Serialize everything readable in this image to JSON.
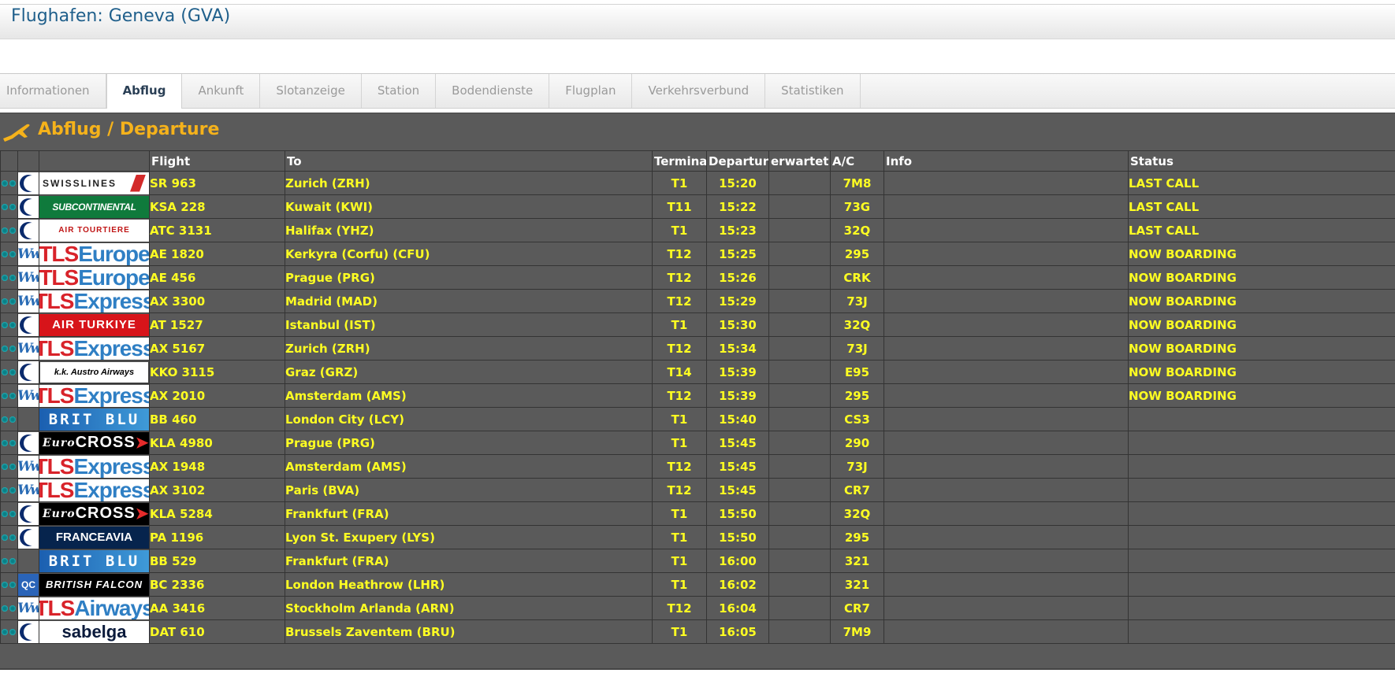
{
  "header": {
    "title": "Flughafen: Geneva (GVA)"
  },
  "tabs": [
    {
      "label": "Informationen",
      "active": false
    },
    {
      "label": "Abflug",
      "active": true
    },
    {
      "label": "Ankunft",
      "active": false
    },
    {
      "label": "Slotanzeige",
      "active": false
    },
    {
      "label": "Station",
      "active": false
    },
    {
      "label": "Bodendienste",
      "active": false
    },
    {
      "label": "Flugplan",
      "active": false
    },
    {
      "label": "Verkehrsverbund",
      "active": false
    },
    {
      "label": "Statistiken",
      "active": false
    }
  ],
  "board": {
    "title": "Abflug / Departure",
    "title_icon": "plane-departure-icon",
    "accent_color": "#f5b21b",
    "text_color": "#ffff22",
    "columns": {
      "flight": "Flight",
      "to": "To",
      "terminal": "Terminal",
      "departure": "Departure",
      "expected": "erwartet",
      "ac": "A/C",
      "info": "Info",
      "status": "Status"
    },
    "rows": [
      {
        "mini": "crescent",
        "logo": {
          "style": "swiss",
          "text": "SWISSLINES"
        },
        "flight": "SR 963",
        "to": "Zurich (ZRH)",
        "terminal": "T1",
        "departure": "15:20",
        "expected": "",
        "ac": "7M8",
        "info": "",
        "status": "LAST CALL"
      },
      {
        "mini": "crescent",
        "logo": {
          "style": "subcont",
          "text": "SUBCONTINENTAL"
        },
        "flight": "KSA 228",
        "to": "Kuwait (KWI)",
        "terminal": "T11",
        "departure": "15:22",
        "expected": "",
        "ac": "73G",
        "info": "",
        "status": "LAST CALL"
      },
      {
        "mini": "crescent",
        "logo": {
          "style": "tourair",
          "text": "AIR TOURTIERE"
        },
        "flight": "ATC 3131",
        "to": "Halifax (YHZ)",
        "terminal": "T1",
        "departure": "15:23",
        "expected": "",
        "ac": "32Q",
        "info": "",
        "status": "LAST CALL"
      },
      {
        "mini": "ww",
        "logo": {
          "style": "tls",
          "a": "TLS",
          "b": "Europe"
        },
        "flight": "AE 1820",
        "to": "Kerkyra (Corfu) (CFU)",
        "terminal": "T12",
        "departure": "15:25",
        "expected": "",
        "ac": "295",
        "info": "",
        "status": "NOW BOARDING"
      },
      {
        "mini": "ww",
        "logo": {
          "style": "tls",
          "a": "TLS",
          "b": "Europe"
        },
        "flight": "AE 456",
        "to": "Prague (PRG)",
        "terminal": "T12",
        "departure": "15:26",
        "expected": "",
        "ac": "CRK",
        "info": "",
        "status": "NOW BOARDING"
      },
      {
        "mini": "ww",
        "logo": {
          "style": "tls",
          "a": "TLS",
          "b": "Express"
        },
        "flight": "AX 3300",
        "to": "Madrid (MAD)",
        "terminal": "T12",
        "departure": "15:29",
        "expected": "",
        "ac": "73J",
        "info": "",
        "status": "NOW BOARDING"
      },
      {
        "mini": "crescent",
        "logo": {
          "style": "turk",
          "text": "AIR TURKIYE"
        },
        "flight": "AT 1527",
        "to": "Istanbul (IST)",
        "terminal": "T1",
        "departure": "15:30",
        "expected": "",
        "ac": "32Q",
        "info": "",
        "status": "NOW BOARDING"
      },
      {
        "mini": "ww",
        "logo": {
          "style": "tls",
          "a": "TLS",
          "b": "Express"
        },
        "flight": "AX 5167",
        "to": "Zurich (ZRH)",
        "terminal": "T12",
        "departure": "15:34",
        "expected": "",
        "ac": "73J",
        "info": "",
        "status": "NOW BOARDING"
      },
      {
        "mini": "crescent",
        "logo": {
          "style": "austro",
          "text": "k.k. Austro Airways"
        },
        "flight": "KKO 3115",
        "to": "Graz (GRZ)",
        "terminal": "T14",
        "departure": "15:39",
        "expected": "",
        "ac": "E95",
        "info": "",
        "status": "NOW BOARDING"
      },
      {
        "mini": "ww",
        "logo": {
          "style": "tls",
          "a": "TLS",
          "b": "Express"
        },
        "flight": "AX 2010",
        "to": "Amsterdam (AMS)",
        "terminal": "T12",
        "departure": "15:39",
        "expected": "",
        "ac": "295",
        "info": "",
        "status": "NOW BOARDING"
      },
      {
        "mini": "empty",
        "logo": {
          "style": "brit",
          "text": "BRIT BLU"
        },
        "flight": "BB 460",
        "to": "London City (LCY)",
        "terminal": "T1",
        "departure": "15:40",
        "expected": "",
        "ac": "CS3",
        "info": "",
        "status": ""
      },
      {
        "mini": "crescent",
        "logo": {
          "style": "euro",
          "a": "Euro",
          "b": "CROSS"
        },
        "flight": "KLA 4980",
        "to": "Prague (PRG)",
        "terminal": "T1",
        "departure": "15:45",
        "expected": "",
        "ac": "290",
        "info": "",
        "status": ""
      },
      {
        "mini": "ww",
        "logo": {
          "style": "tls",
          "a": "TLS",
          "b": "Express"
        },
        "flight": "AX 1948",
        "to": "Amsterdam (AMS)",
        "terminal": "T12",
        "departure": "15:45",
        "expected": "",
        "ac": "73J",
        "info": "",
        "status": ""
      },
      {
        "mini": "ww",
        "logo": {
          "style": "tls",
          "a": "TLS",
          "b": "Express"
        },
        "flight": "AX 3102",
        "to": "Paris (BVA)",
        "terminal": "T12",
        "departure": "15:45",
        "expected": "",
        "ac": "CR7",
        "info": "",
        "status": ""
      },
      {
        "mini": "crescent",
        "logo": {
          "style": "euro",
          "a": "Euro",
          "b": "CROSS"
        },
        "flight": "KLA 5284",
        "to": "Frankfurt (FRA)",
        "terminal": "T1",
        "departure": "15:50",
        "expected": "",
        "ac": "32Q",
        "info": "",
        "status": ""
      },
      {
        "mini": "crescent",
        "logo": {
          "style": "france",
          "text": "FRANCEAVIA"
        },
        "flight": "PA 1196",
        "to": "Lyon St. Exupery (LYS)",
        "terminal": "T1",
        "departure": "15:50",
        "expected": "",
        "ac": "295",
        "info": "",
        "status": ""
      },
      {
        "mini": "empty",
        "logo": {
          "style": "brit",
          "text": "BRIT BLU"
        },
        "flight": "BB 529",
        "to": "Frankfurt (FRA)",
        "terminal": "T1",
        "departure": "16:00",
        "expected": "",
        "ac": "321",
        "info": "",
        "status": ""
      },
      {
        "mini": "qc",
        "logo": {
          "style": "falcon",
          "text": "BRITISH FALCON"
        },
        "flight": "BC 2336",
        "to": "London Heathrow (LHR)",
        "terminal": "T1",
        "departure": "16:02",
        "expected": "",
        "ac": "321",
        "info": "",
        "status": ""
      },
      {
        "mini": "ww",
        "logo": {
          "style": "tls",
          "a": "TLS",
          "b": "Airways"
        },
        "flight": "AA 3416",
        "to": "Stockholm Arlanda (ARN)",
        "terminal": "T12",
        "departure": "16:04",
        "expected": "",
        "ac": "CR7",
        "info": "",
        "status": ""
      },
      {
        "mini": "crescent",
        "logo": {
          "style": "sabelga",
          "text": "sabelga"
        },
        "flight": "DAT 610",
        "to": "Brussels Zaventem (BRU)",
        "terminal": "T1",
        "departure": "16:05",
        "expected": "",
        "ac": "7M9",
        "info": "",
        "status": ""
      }
    ]
  }
}
